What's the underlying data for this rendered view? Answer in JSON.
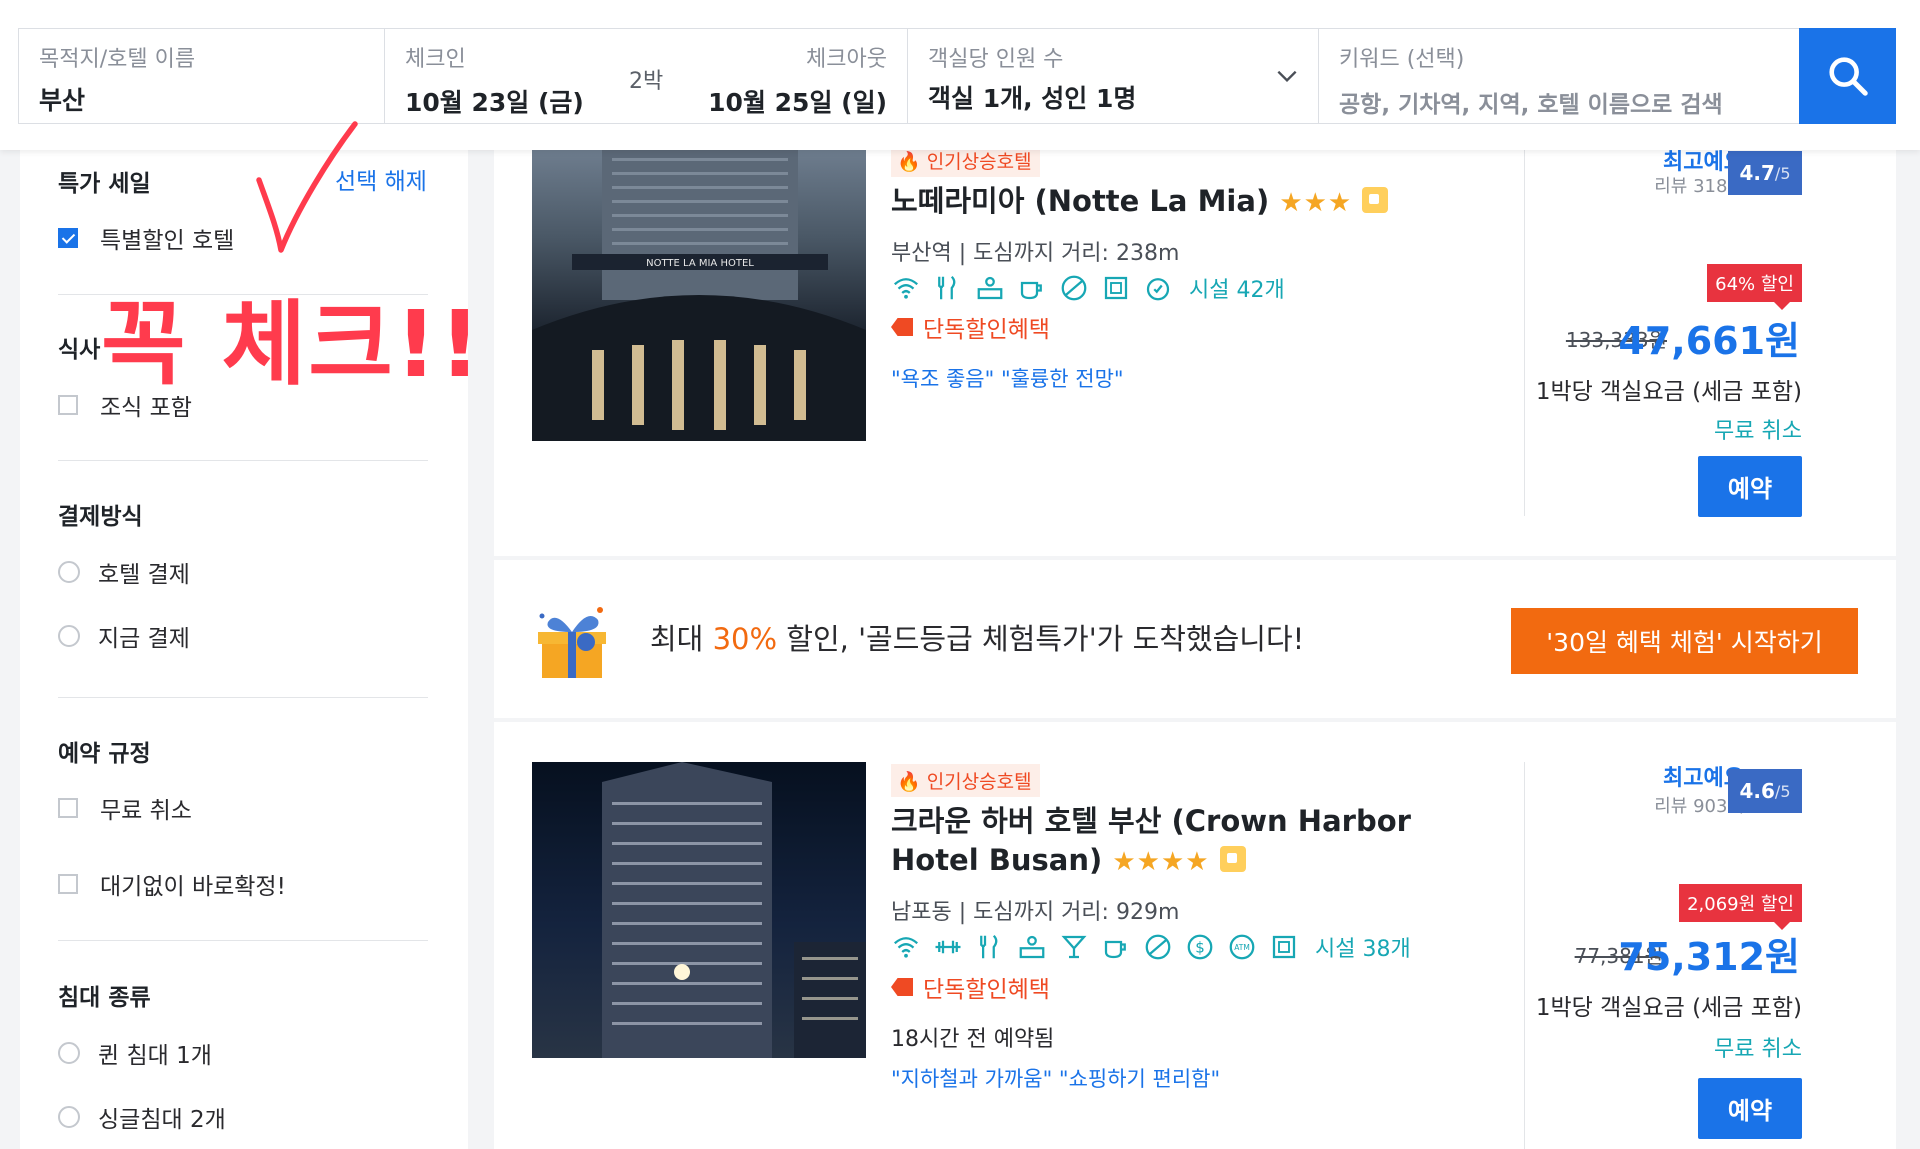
{
  "search": {
    "destination_label": "목적지/호텔 이름",
    "destination_value": "부산",
    "checkin_label": "체크인",
    "checkin_value": "10월 23일 (금)",
    "nights": "2박",
    "checkout_label": "체크아웃",
    "checkout_value": "10월 25일 (일)",
    "guests_label": "객실당 인원 수",
    "guests_value": "객실 1개, 성인 1명",
    "keyword_label": "키워드 (선택)",
    "keyword_placeholder": "공항, 기차역, 지역, 호텔 이름으로 검색",
    "search_icon": "search-icon"
  },
  "sidebar": {
    "special_sale": {
      "title": "특가 세일",
      "clear": "선택 해제",
      "option": "특별할인 호텔",
      "checked": true
    },
    "meal": {
      "title": "식사",
      "option": "조식 포함"
    },
    "payment": {
      "title": "결제방식",
      "options": [
        "호텔 결제",
        "지금 결제"
      ]
    },
    "policy": {
      "title": "예약 규정",
      "options": [
        "무료 취소",
        "대기없이 바로확정!"
      ]
    },
    "bed": {
      "title": "침대 종류",
      "options": [
        "퀸 침대 1개",
        "싱글침대 2개"
      ]
    }
  },
  "annotation": {
    "text": "꼭 체크!!",
    "color": "#ff3b4d"
  },
  "hotels": [
    {
      "badge": "인기상승호텔",
      "name": "노떼라미아 (Notte La Mia)",
      "stars": "★★★",
      "location": "부산역 | 도심까지 거리: 238m",
      "amenities_count": "시설 42개",
      "promo": "단독할인혜택",
      "quotes": "\"욕조 좋음\" \"훌륭한 전망\"",
      "rating_word": "최고예요",
      "review_count": "리뷰 318개",
      "score": "4.7",
      "score_max": "/5",
      "discount": "64% 할인",
      "original_price": "133,333원",
      "price": "47,661원",
      "price_note": "1박당 객실요금 (세금 포함)",
      "cancel": "무료 취소",
      "book": "예약"
    },
    {
      "badge": "인기상승호텔",
      "name": "크라운 하버 호텔 부산 (Crown Harbor Hotel Busan)",
      "stars": "★★★★",
      "location": "남포동 | 도심까지 거리: 929m",
      "amenities_count": "시설 38개",
      "promo": "단독할인혜택",
      "booked": "18시간 전 예약됨",
      "quotes": "\"지하철과 가까움\" \"쇼핑하기 편리함\"",
      "rating_word": "최고예요",
      "review_count": "리뷰 903개",
      "score": "4.6",
      "score_max": "/5",
      "discount": "2,069원 할인",
      "original_price": "77,381원",
      "price": "75,312원",
      "price_note": "1박당 객실요금 (세금 포함)",
      "cancel": "무료 취소",
      "book": "예약"
    }
  ],
  "banner": {
    "text_before": "최대 ",
    "highlight": "30%",
    "text_after": " 할인, '골드등급 체험특가'가 도착했습니다!",
    "button": "'30일 혜택 체험' 시작하기"
  },
  "colors": {
    "accent": "#1a73e8",
    "orange": "#f26a10",
    "teal": "#17a7b4",
    "sale_red": "#e8333f"
  }
}
